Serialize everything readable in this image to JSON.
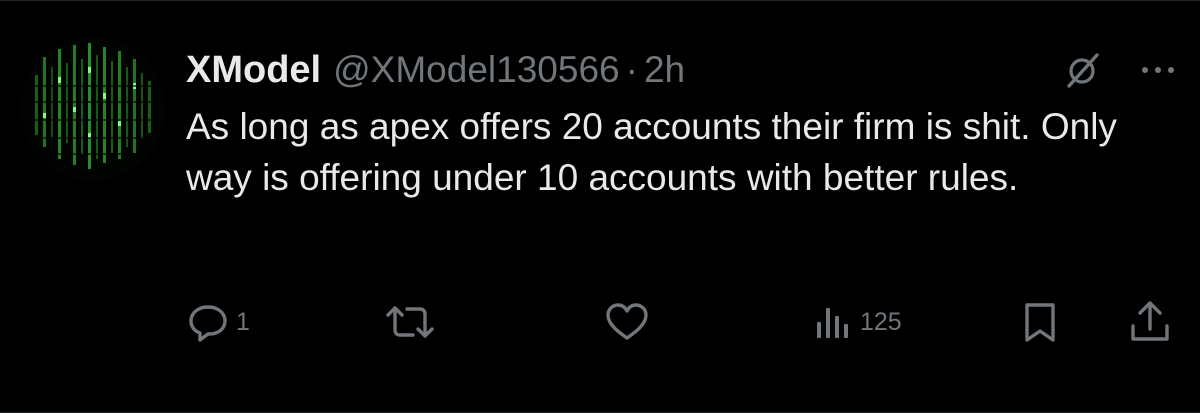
{
  "tweet": {
    "display_name": "XModel",
    "handle": "@XModel130566",
    "separator": "·",
    "time": "2h",
    "text": "As long as apex offers 20 accounts their firm is shit. Only way is offering under 10 accounts with better rules."
  },
  "actions": {
    "reply_count": "1",
    "views_count": "125"
  },
  "icons": {
    "grok": "grok-icon",
    "more": "more-icon",
    "reply": "reply-icon",
    "retweet": "retweet-icon",
    "like": "heart-icon",
    "views": "views-icon",
    "bookmark": "bookmark-icon",
    "share": "share-icon"
  },
  "colors": {
    "background": "#000000",
    "text_primary": "#e7e9ea",
    "text_secondary": "#71767b",
    "avatar_green": "#3fbf3f"
  }
}
